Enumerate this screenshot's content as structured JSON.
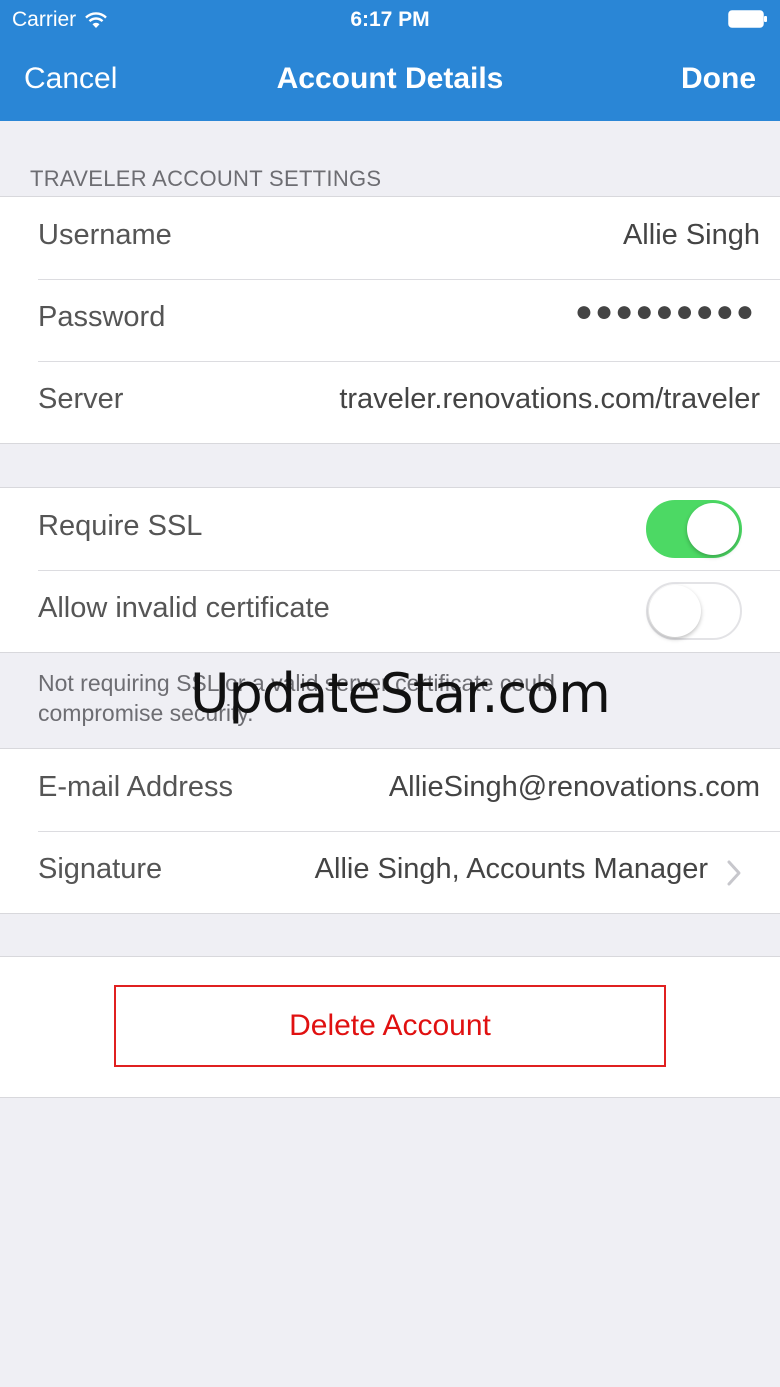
{
  "status_bar": {
    "carrier": "Carrier",
    "time": "6:17 PM"
  },
  "nav": {
    "cancel": "Cancel",
    "title": "Account Details",
    "done": "Done"
  },
  "section_header": "TRAVELER ACCOUNT SETTINGS",
  "account": {
    "username_label": "Username",
    "username_value": "Allie Singh",
    "password_label": "Password",
    "password_value": "●●●●●●●●●",
    "server_label": "Server",
    "server_value": "traveler.renovations.com/traveler"
  },
  "security": {
    "require_ssl_label": "Require SSL",
    "require_ssl_on": true,
    "allow_invalid_label": "Allow invalid certificate",
    "allow_invalid_on": false,
    "note": "Not requiring SSL or a valid server certificate could compromise security."
  },
  "watermark": "UpdateStar.com",
  "mail": {
    "email_label": "E-mail Address",
    "email_value": "AllieSingh@renovations.com",
    "signature_label": "Signature",
    "signature_value": "Allie Singh, Accounts Manager"
  },
  "delete_label": "Delete Account",
  "colors": {
    "nav_bg": "#2a86d6",
    "toggle_on": "#4cd964",
    "destructive": "#e01010",
    "background": "#efeff4"
  }
}
